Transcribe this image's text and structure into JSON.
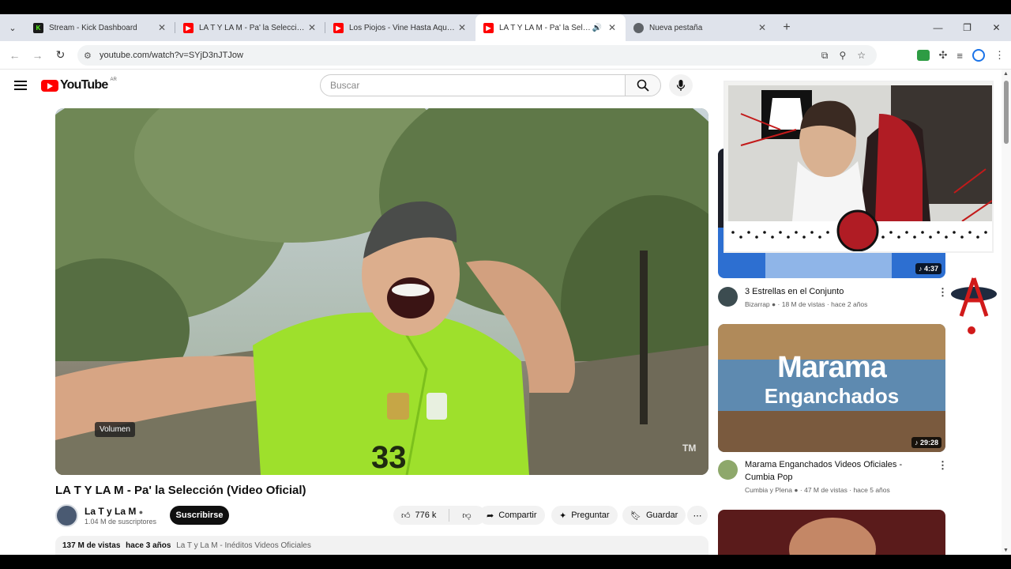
{
  "tabs": [
    {
      "title": "Stream - Kick Dashboard",
      "favicon": "kick-icon",
      "color": "#53fc18",
      "active": false
    },
    {
      "title": "LA T Y LA M - Pa' la Selección (V",
      "favicon": "youtube-icon",
      "color": "#ff0000",
      "active": false
    },
    {
      "title": "Los Piojos - Vine Hasta Aquí (C",
      "favicon": "youtube-icon",
      "color": "#ff0000",
      "active": false
    },
    {
      "title": "LA T Y LA M - Pa' la Selecci",
      "favicon": "youtube-icon",
      "color": "#ff0000",
      "active": true
    },
    {
      "title": "Nueva pestaña",
      "favicon": "chrome-icon",
      "color": "#5f6368",
      "active": false
    }
  ],
  "address": {
    "url": "youtube.com/watch?v=SYjD3nJTJow"
  },
  "youtube": {
    "logo_text": "YouTube",
    "country": "AR",
    "search_placeholder": "Buscar"
  },
  "video": {
    "title": "LA T Y LA M - Pa' la Selección (Video Oficial)",
    "channel": "La T y La M",
    "subscribers": "1.04 M de suscriptores",
    "subscribe_label": "Suscribirse",
    "likes": "776 k",
    "share_label": "Compartir",
    "ask_label": "Preguntar",
    "save_label": "Guardar",
    "views": "137 M de vistas",
    "age": "hace 3 años",
    "tags": "La T y La M - Inéditos Videos Oficiales",
    "volume_tooltip": "Volumen",
    "watermark": "TM"
  },
  "related": [
    {
      "title": "3 Estrellas en el Conjunto",
      "channel": "Bizarrap",
      "meta": "18 M de vistas · hace 2 años",
      "duration": "4:37"
    },
    {
      "title": "Marama Enganchados Videos Oficiales - Cumbia Pop",
      "channel": "Cumbia y Plena",
      "meta": "47 M de vistas · hace 5 años",
      "duration": "29:28",
      "thumb_text_1": "Marama",
      "thumb_text_2": "Enganchados"
    }
  ]
}
